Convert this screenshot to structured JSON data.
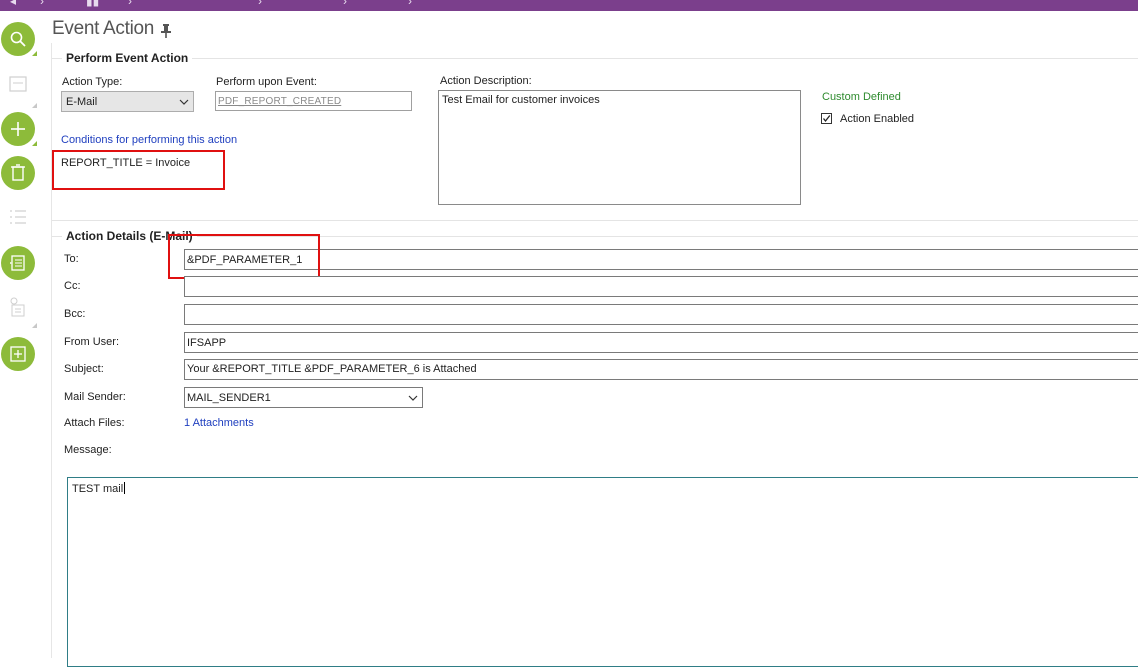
{
  "header": {
    "title": "Event Action"
  },
  "perform": {
    "group_title": "Perform Event Action",
    "action_type_label": "Action Type:",
    "action_type_value": "E-Mail",
    "event_label": "Perform upon Event:",
    "event_value": "PDF_REPORT_CREATED",
    "conditions_link": "Conditions for performing this action",
    "condition_text": "REPORT_TITLE = Invoice",
    "description_label": "Action Description:",
    "description_value": "Test Email for customer invoices",
    "custom_defined": "Custom Defined",
    "action_enabled_label": "Action Enabled",
    "action_enabled_checked": true
  },
  "details": {
    "group_title": "Action Details (E-Mail)",
    "to_label": "To:",
    "to_value": "&PDF_PARAMETER_1",
    "cc_label": "Cc:",
    "cc_value": "",
    "bcc_label": "Bcc:",
    "bcc_value": "",
    "from_user_label": "From User:",
    "from_user_value": "IFSAPP",
    "subject_label": "Subject:",
    "subject_value": "Your &REPORT_TITLE &PDF_PARAMETER_6 is Attached",
    "mail_sender_label": "Mail Sender:",
    "mail_sender_value": "MAIL_SENDER1",
    "attach_label": "Attach Files:",
    "attach_value": "1 Attachments",
    "message_label": "Message:",
    "message_value": "TEST mail"
  },
  "sidebar_icons": [
    "search-icon",
    "form-icon",
    "add-icon",
    "delete-icon",
    "list-icon",
    "details-icon",
    "form-detail-icon",
    "new-document-icon"
  ],
  "colors": {
    "topbar": "#7b3f8c",
    "accent_green": "#8dbb3a",
    "highlight_red": "#e01010",
    "link_blue": "#1f3fbf",
    "custom_green": "#2e8b2e"
  }
}
